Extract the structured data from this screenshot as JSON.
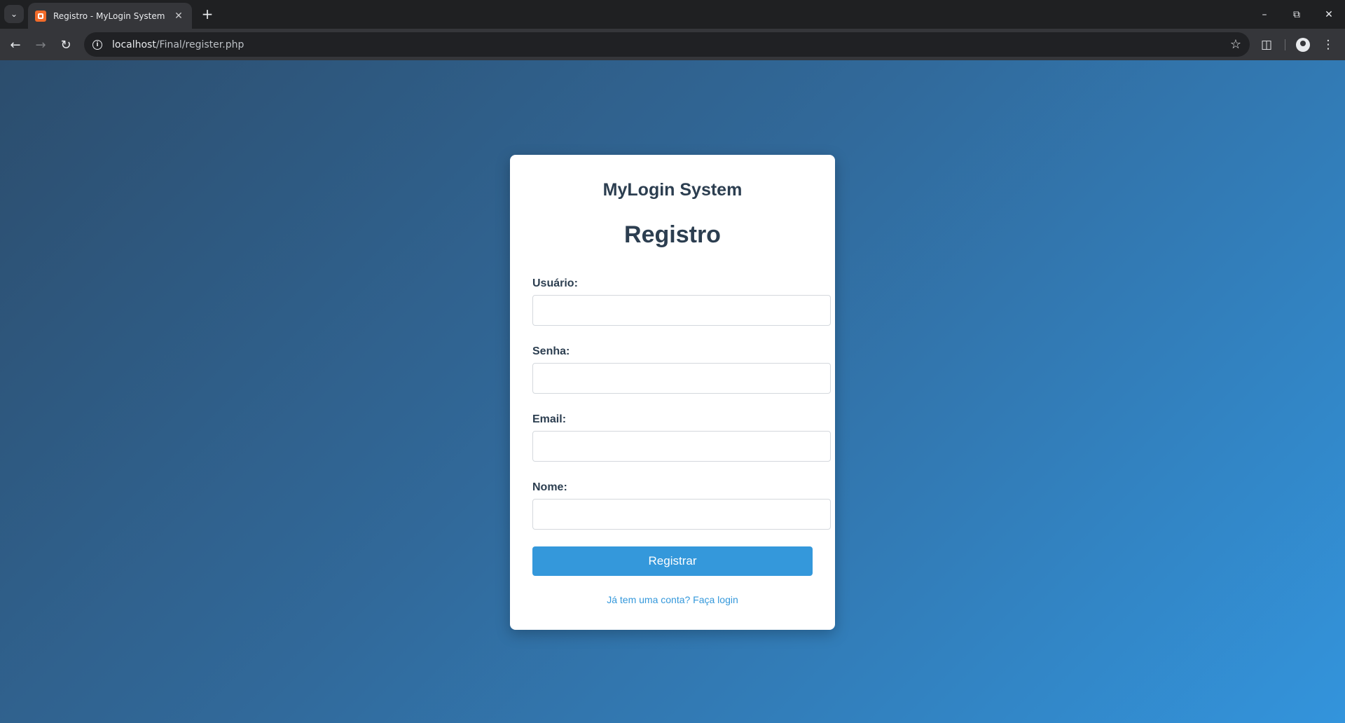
{
  "browser": {
    "tab_title": "Registro - MyLogin System",
    "url_host": "localhost",
    "url_path": "/Final/register.php"
  },
  "page": {
    "brand": "MyLogin System",
    "heading": "Registro",
    "fields": [
      {
        "label": "Usuário:",
        "value": "",
        "type": "text"
      },
      {
        "label": "Senha:",
        "value": "",
        "type": "password"
      },
      {
        "label": "Email:",
        "value": "",
        "type": "email"
      },
      {
        "label": "Nome:",
        "value": "",
        "type": "text"
      }
    ],
    "submit_label": "Registrar",
    "login_link": "Já tem uma conta? Faça login"
  },
  "colors": {
    "accent": "#3498db",
    "heading": "#2c3e50",
    "favicon": "#f26b2a"
  }
}
